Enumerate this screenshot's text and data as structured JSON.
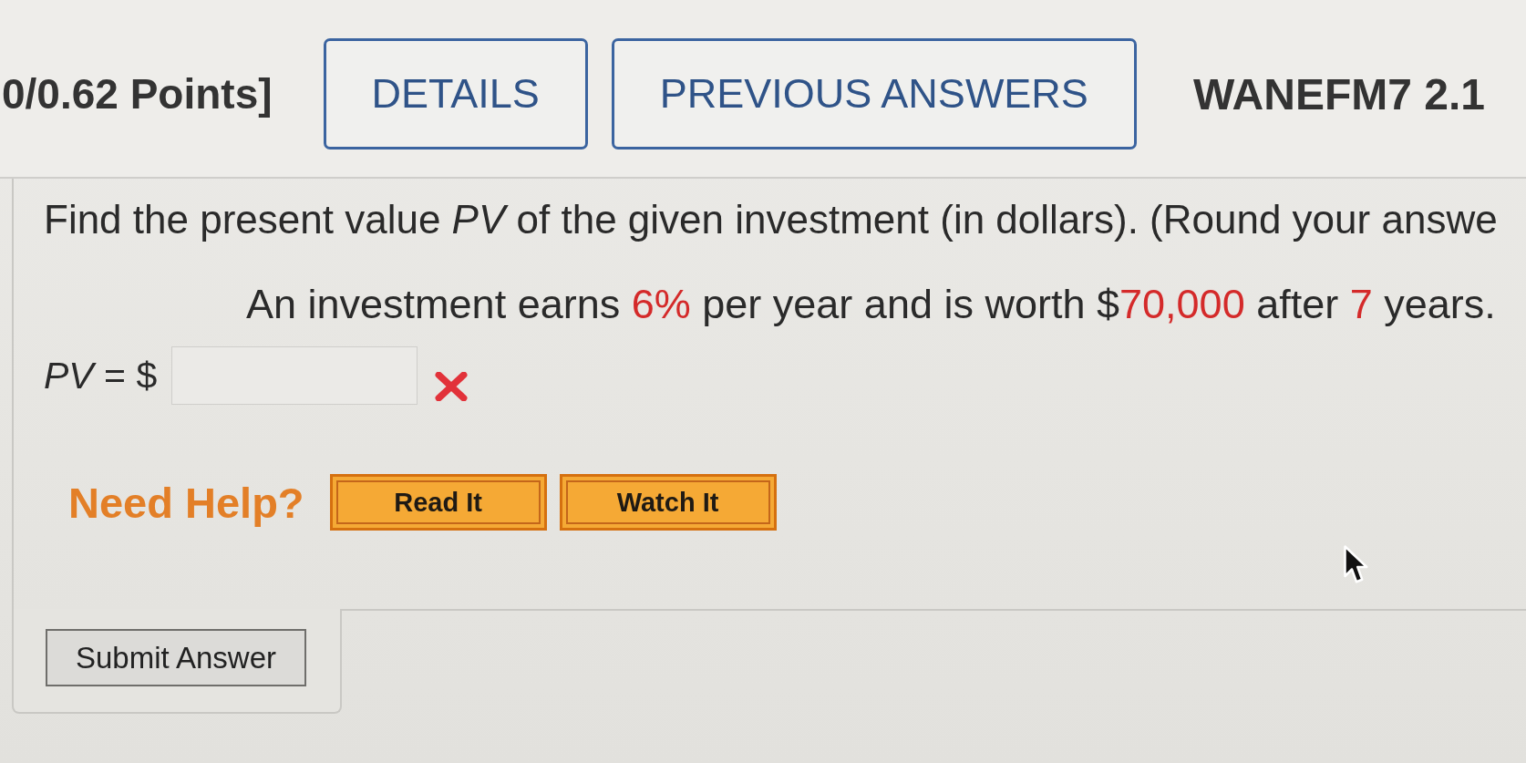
{
  "header": {
    "points": "0/0.62 Points]",
    "buttons": [
      {
        "label": "DETAILS"
      },
      {
        "label": "PREVIOUS ANSWERS"
      }
    ],
    "problem_id": "WANEFM7 2.1"
  },
  "question": {
    "prompt": "Find the present value *PV* of the given investment (in dollars). (Round your answe",
    "scenario": [
      {
        "text": "An investment earns ",
        "given": false
      },
      {
        "text": "6%",
        "given": true
      },
      {
        "text": " per year and is worth $",
        "given": false
      },
      {
        "text": "70,000",
        "given": true
      },
      {
        "text": " after ",
        "given": false
      },
      {
        "text": "7",
        "given": true
      },
      {
        "text": " years.",
        "given": false
      }
    ]
  },
  "answer": {
    "label": "*PV* = $",
    "correct": false
  },
  "help": {
    "label": "Need Help?",
    "buttons": [
      {
        "label": "Read It"
      },
      {
        "label": "Watch It"
      }
    ]
  },
  "submit": {
    "label": "Submit Answer"
  }
}
